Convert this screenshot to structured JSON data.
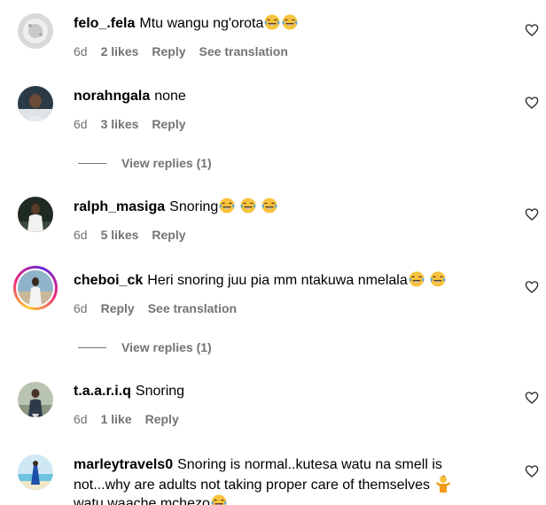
{
  "comments": [
    {
      "username": "felo_.fela",
      "text": "Mtu wangu ng'orota",
      "emoji_count": 2,
      "time": "6d",
      "likes": "2 likes",
      "reply": "Reply",
      "translation": "See translation"
    },
    {
      "username": "norahngala",
      "text": "none",
      "emoji_count": 0,
      "time": "6d",
      "likes": "3 likes",
      "reply": "Reply",
      "view_replies": "View replies (1)"
    },
    {
      "username": "ralph_masiga",
      "text": "Snoring",
      "emoji_count": 3,
      "time": "6d",
      "likes": "5 likes",
      "reply": "Reply"
    },
    {
      "username": "cheboi_ck",
      "text": "Heri snoring juu pia mm ntakuwa nmelala",
      "emoji_count": 2,
      "time": "6d",
      "reply": "Reply",
      "translation": "See translation",
      "view_replies": "View replies (1)"
    },
    {
      "username": "t.a.a.r.i.q",
      "text": "Snoring",
      "emoji_count": 0,
      "time": "6d",
      "likes": "1 like",
      "reply": "Reply"
    },
    {
      "username": "marleytravels0",
      "text_line1": "Snoring is normal..kutesa watu na smell is",
      "text_line2": "not...why are adults not taking proper care of themselves",
      "text_line3": "watu waache mchezo"
    }
  ],
  "icons": {
    "like": "heart-outline-icon",
    "emoji": "face-with-tears-of-joy-icon",
    "person_emoji": "person-shrugging-icon"
  },
  "colors": {
    "text": "#000000",
    "meta": "#737373",
    "story_ring": [
      "#f9ce34",
      "#ee2a7b",
      "#6228d7"
    ],
    "emoji_face": "#f7c33e"
  }
}
